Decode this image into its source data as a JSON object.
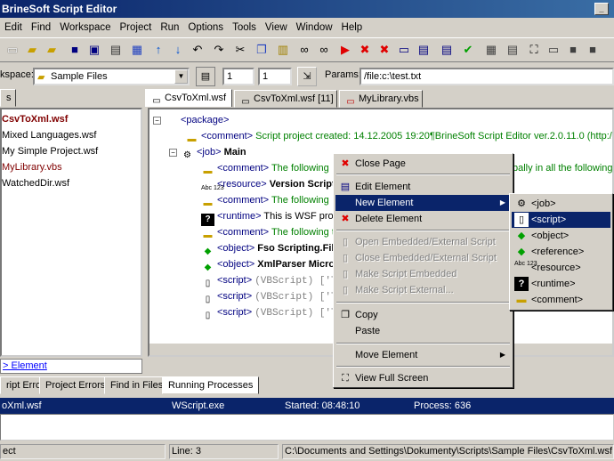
{
  "title": "BrineSoft Script Editor",
  "menu": [
    "Edit",
    "Find",
    "Workspace",
    "Project",
    "Run",
    "Options",
    "Tools",
    "View",
    "Window",
    "Help"
  ],
  "toolbar_icons": [
    "new-file-icon",
    "open-folder-icon",
    "open-icon",
    "save-icon",
    "save-all-icon",
    "print-icon",
    "find-icon",
    "arrow-up-icon",
    "arrow-down-icon",
    "undo-icon",
    "redo-icon",
    "cut-icon",
    "copy-icon",
    "paste-icon",
    "binoculars-icon",
    "binoculars-next-icon",
    "run-icon",
    "stop-icon",
    "record-icon",
    "window-icon",
    "list-icon",
    "check-icon",
    "settings-icon",
    "fullscreen-icon",
    "panel-icon",
    "box-icon",
    "box2-icon"
  ],
  "workspace": {
    "label": "kspace:",
    "value": "Sample Files",
    "field1": "1",
    "field2": "1",
    "params_label": "Params:",
    "params_value": "/file:c:\\test.txt"
  },
  "left": {
    "header_tab": "s",
    "items": [
      "CsvToXml.wsf",
      "Mixed Languages.wsf",
      "My Simple Project.wsf",
      "MyLibrary.vbs",
      "WatchedDir.wsf"
    ],
    "link": "> Element"
  },
  "doc_tabs": [
    "CsvToXml.wsf",
    "CsvToXml.wsf [11]",
    "MyLibrary.vbs"
  ],
  "tree": {
    "package": "<package>",
    "comment1_tag": "<comment>",
    "comment1_text": "Script project created: 14.12.2005 19:20¶BrineSoft Script Editor ver.2.0.11.0 (http://www",
    "job_tag": "<job>",
    "job_name": "Main",
    "rows": [
      {
        "tag": "<comment>",
        "text": "The following",
        "icon": "comment-icon"
      },
      {
        "tag": "<resource>",
        "text": "Version  Script",
        "icon": "resource-icon"
      },
      {
        "tag": "<comment>",
        "text": "The following",
        "icon": "comment-icon"
      },
      {
        "tag": "<runtime>",
        "text": "This is WSF proje",
        "icon": "runtime-icon"
      },
      {
        "tag": "<comment>",
        "text": "The following tw",
        "icon": "comment-icon"
      },
      {
        "tag": "<object>",
        "text": "Fso  Scripting.File",
        "icon": "object-icon"
      },
      {
        "tag": "<object>",
        "text": "XmlParser  Micro",
        "icon": "object-icon"
      },
      {
        "tag": "<script>",
        "text": "(VBScript)  ['Thi",
        "icon": "script-icon"
      },
      {
        "tag": "<script>",
        "text": "(VBScript)  ['Thi",
        "icon": "script-icon"
      },
      {
        "tag": "<script>",
        "text": "(VBScript)  ['Thi",
        "icon": "script-icon"
      }
    ],
    "right_tail": "bally in all the following e"
  },
  "context_menu": [
    "Close Page",
    "Edit Element",
    "New Element",
    "Delete Element",
    "Open Embedded/External Script",
    "Close Embedded/External Script",
    "Make Script Embedded",
    "Make Script External...",
    "Copy",
    "Paste",
    "Move Element",
    "View Full Screen"
  ],
  "submenu": [
    "<job>",
    "<script>",
    "<object>",
    "<reference>",
    "<resource>",
    "<runtime>",
    "<comment>"
  ],
  "bottom_tabs": [
    "ript Errors",
    "Project Errors",
    "Find in Files",
    "Running Processes"
  ],
  "running": {
    "file": "oXml.wsf",
    "host": "WScript.exe",
    "started": "Started: 08:48:10",
    "process": "Process: 636"
  },
  "status": {
    "left": "ect",
    "line": "Line: 3",
    "path": "C:\\Documents and Settings\\Dokumenty\\Scripts\\Sample Files\\CsvToXml.wsf"
  }
}
